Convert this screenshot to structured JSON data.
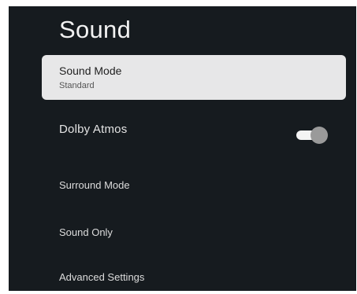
{
  "page": {
    "title": "Sound"
  },
  "menu": {
    "items": [
      {
        "label": "Sound Mode",
        "value": "Standard",
        "selected": true
      },
      {
        "label": "Dolby Atmos",
        "toggle": true,
        "toggle_on": true
      },
      {
        "label": "Surround Mode"
      },
      {
        "label": "Sound Only"
      },
      {
        "label": "Advanced Settings"
      }
    ]
  },
  "colors": {
    "background": "#161b1f",
    "selected_row": "#e7e7e8",
    "toggle_track": "#f4f4f4",
    "toggle_knob": "#9a9a9a"
  }
}
